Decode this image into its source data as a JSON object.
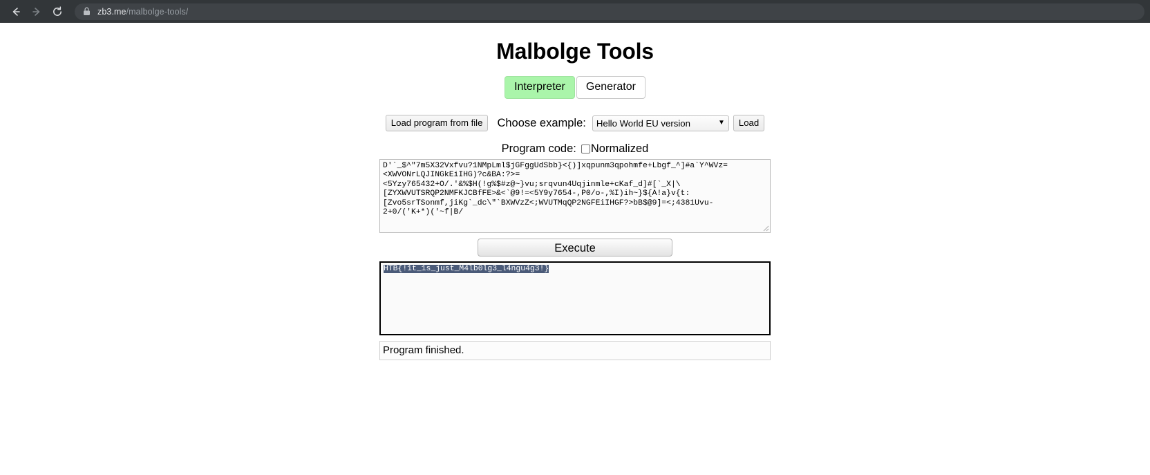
{
  "browser": {
    "back_icon": "back-arrow-icon",
    "forward_icon": "forward-arrow-icon",
    "reload_icon": "reload-icon",
    "lock_icon": "lock-icon",
    "url_host": "zb3.me",
    "url_path": "/malbolge-tools/"
  },
  "page": {
    "title": "Malbolge Tools"
  },
  "tabs": [
    {
      "label": "Interpreter",
      "active": true
    },
    {
      "label": "Generator",
      "active": false
    }
  ],
  "toolbar": {
    "load_file_label": "Load program from file",
    "choose_example_label": "Choose example:",
    "example_selected": "Hello World EU version",
    "example_options": [
      "Hello World EU version"
    ],
    "load_label": "Load"
  },
  "code_section": {
    "label": "Program code:",
    "normalized_label": "Normalized",
    "normalized_checked": false,
    "code": "D'`_$^\"7m5X32Vxfvu?1NMpLml$jGFggUdSbb}<{)]xqpunm3qpohmfe+Lbgf_^]#a`Y^WVz=\n<XWVONrLQJINGkEiIHG)?c&BA:?>=\n<5Yzy765432+O/.'&%$H(!g%$#z@~}vu;srqvun4Uqjinmle+cKaf_d]#[`_X|\\\n[ZYXWVUTSRQP2NMFKJCBfFE>&<`@9!=<5Y9y7654-,P0/o-,%I)ih~}${A!a}v{t:\n[Zvo5srTSonmf,jiKg`_dc\\\"`BXWVzZ<;WVUTMqQP2NGFEiIHGF?>bB$@9]=<;4381Uvu-\n2+0/('K+*)('~f|B/"
  },
  "execute": {
    "label": "Execute"
  },
  "output": {
    "text": "HTB{!1t_1s_just_M4lb0lg3_l4ngu4g3!}",
    "selected": true
  },
  "status": {
    "text": "Program finished."
  },
  "colors": {
    "chrome_bg": "#323639",
    "address_bg": "#3f4347",
    "active_tab_green": "#aaf5aa",
    "selection_blue": "#4a5a78"
  }
}
